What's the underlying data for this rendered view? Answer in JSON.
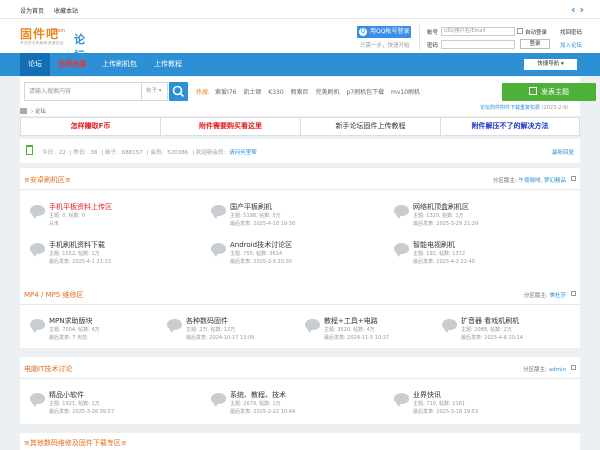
{
  "topbar": {
    "set_home": "设为首页",
    "bookmark": "收藏本站",
    "toggle_icon": "code-arrows-icon"
  },
  "logo": {
    "main": "固件吧",
    "domain": ".com",
    "sub": "专业的手机刷机资源社区",
    "forum": "论坛"
  },
  "header": {
    "qq_login": "用QQ帐号登录",
    "qq_tip": "只需一步，快速开始",
    "login": {
      "account_label": "帐号",
      "account_placeholder": "UID/用户名/Email",
      "auto_login": "自动登录",
      "find_password": "找回密码",
      "password_label": "密码",
      "login_button": "登录",
      "register": "加入论坛"
    }
  },
  "nav": {
    "items": [
      "论坛",
      "在线充值",
      "上传刷机包",
      "上传教程"
    ],
    "quick": "快捷导航"
  },
  "search": {
    "placeholder": "请输入搜索内容",
    "type": "帖子",
    "hot_label": "热搜:",
    "hot_words": [
      "索爱I76",
      "凯士顿",
      "K330",
      "假索尼",
      "完美刷机",
      "p7刷机包下载",
      "mv10刷机"
    ],
    "post_button": "发表主题",
    "notice": "论坛附件附件下载重复扣费",
    "notice_date": "(2023-2-9)"
  },
  "breadcrumb": {
    "current": "论坛"
  },
  "banner": [
    "怎样赚取F币",
    "附件需要购买看这里",
    "新手论坛固件上传教程",
    "附件解压不了的解决方法"
  ],
  "stats": {
    "today_l": "今日:",
    "today": "22",
    "yesterday_l": "昨日:",
    "yesterday": "38",
    "posts_l": "帖子:",
    "posts": "688157",
    "members_l": "会员:",
    "members": "520386",
    "welcome": "欢迎新会员:",
    "new_member": "请问何里帮",
    "newest": "最新回复"
  },
  "sections": [
    {
      "title": "≡安卓刷机区≡",
      "mod_label": "分区版主:",
      "mods": "午夜咖啡, 梦幻精品",
      "forums": [
        {
          "name": "手机平板资料上传区",
          "stats": "主题: 0, 帖数: 0",
          "last": "从未"
        },
        {
          "name": "国产平板刷机",
          "stats": "主题: 5198, 帖数: 5万",
          "last": "最后发表: 2025-4-18 19:30"
        },
        {
          "name": "网络机顶盒刷机区",
          "stats": "主题: 1320, 帖数: 1万",
          "last": "最后发表: 2025-3-29 21:29"
        },
        {
          "name": "手机刷机资料下载",
          "stats": "主题: 1552, 帖数: 1万",
          "last": "最后发表: 2025-4-1 21:13"
        },
        {
          "name": "Android技术讨论区",
          "stats": "主题: 755, 帖数: 3614",
          "last": "最后发表: 2025-3-9 20:30"
        },
        {
          "name": "智能电视刷机",
          "stats": "主题: 192, 帖数: 1372",
          "last": "最后发表: 2025-4-2 22:40"
        }
      ]
    },
    {
      "title": "MP4 / MP5 维修区",
      "mod_label": "分区版主:",
      "mods": "美杜莎",
      "forums": [
        {
          "name": "MPN求助版块",
          "stats": "主题: 7004, 帖数: 4万",
          "last": "最后发表: 7 天前"
        },
        {
          "name": "各种数码固件",
          "stats": "主题: 2万, 帖数: 12万",
          "last": "最后发表: 2024-10-17 13:09"
        },
        {
          "name": "教程+工具+电路",
          "stats": "主题: 3620, 帖数: 4万",
          "last": "最后发表: 2024-11-5 10:37"
        },
        {
          "name": "扩音器 看戏机刷机",
          "stats": "主题: 2088, 帖数: 2万",
          "last": "最后发表: 2025-4-6 20:14"
        }
      ]
    },
    {
      "title": "电脑IT技术讨论",
      "mod_label": "分区版主:",
      "mods": "admin",
      "forums": [
        {
          "name": "精品小软件",
          "stats": "主题: 1921, 帖数: 1万",
          "last": "最后发表: 2025-3-26 09:57"
        },
        {
          "name": "系统、教程、技术",
          "stats": "主题: 2679, 帖数: 1万",
          "last": "最后发表: 2025-2-22 10:44"
        },
        {
          "name": "业界快讯",
          "stats": "主题: 710, 帖数: 2161",
          "last": "最后发表: 2025-3-18 19:53"
        }
      ]
    },
    {
      "title": "≡其他数码维修及固件下载专区≡"
    }
  ]
}
